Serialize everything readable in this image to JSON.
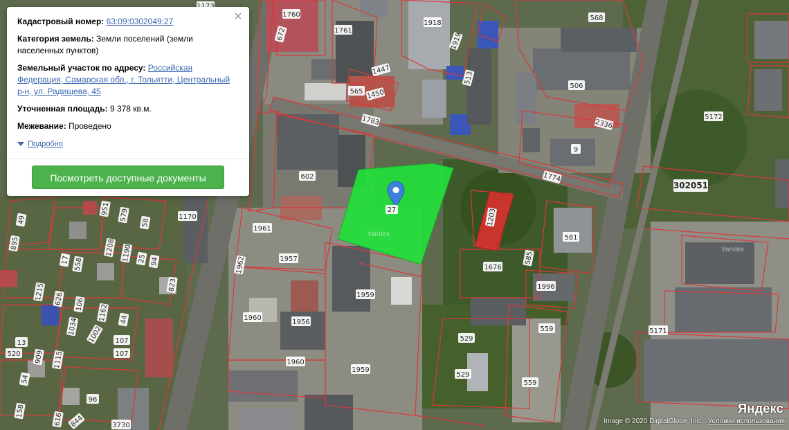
{
  "popup": {
    "cadastral_label": "Кадастровый номер:",
    "cadastral_value": "63:09:0302049:27",
    "category_label": "Категория земель:",
    "category_value": "Земли поселений (земли населенных пунктов)",
    "address_label": "Земельный участок по адресу:",
    "address_value": "Российская Федерация, Самарская обл., г. Тольятти, Центральный р-н, ул. Радищева, 45",
    "area_label": "Уточненная площадь:",
    "area_value": "9 378 кв.м.",
    "survey_label": "Межевание:",
    "survey_value": "Проведено",
    "more_label": "Подробно",
    "docs_button": "Посмотреть доступные документы",
    "close_symbol": "×"
  },
  "footer": {
    "copyright": "Image © 2020 DigitalGlobe, Inc.",
    "terms": "Условия использования",
    "logo": "Яндекс"
  },
  "watermarks": [
    "Yandex",
    "Yandex"
  ],
  "map_labels": {
    "l1760": "1760",
    "l1173": "1173",
    "l672": "672",
    "l1761": "1761",
    "l1918": "1918",
    "l1919": "1919",
    "l568": "568",
    "l1447": "1447",
    "l565": "565",
    "l1450": "1450",
    "l513": "513",
    "l506": "506",
    "l1783": "1783",
    "l2336": "2336",
    "l9": "9",
    "l5172": "5172",
    "l602": "602",
    "l1774": "1774",
    "l302051": "302051",
    "l1170": "1170",
    "l1203": "1203",
    "l1961": "1961",
    "l581": "581",
    "l1957": "1957",
    "l1962": "1962",
    "l1676": "1676",
    "l585": "585",
    "l1996": "1996",
    "l1959a": "1959",
    "l1960a": "1960",
    "l1956": "1956",
    "l5171": "5171",
    "l529a": "529",
    "l529b": "529",
    "l559a": "559",
    "l559b": "559",
    "l1960b": "1960",
    "l1959b": "1959",
    "l3730": "3730",
    "l951": "951",
    "l579": "579",
    "l58": "58",
    "l49": "49",
    "l1208": "1208",
    "l1190": "1190",
    "l25": "25",
    "l94": "94",
    "l558": "558",
    "l17": "17",
    "l895": "895",
    "l823": "823",
    "l626": "626",
    "l106": "106",
    "l1162": "1162",
    "l44": "44",
    "l1215": "1215",
    "l1034": "1034",
    "l1002": "1002",
    "l107a": "107",
    "l107b": "107",
    "l13": "13",
    "l520": "520",
    "l909": "909",
    "l1115": "1115",
    "l54": "54",
    "l96": "96",
    "l158": "158",
    "l616": "616",
    "l844": "844",
    "l27": "27"
  },
  "colors": {
    "selected_parcel": "#22e03a",
    "highlight_parcel": "#e03030",
    "boundary": "#d83a3a",
    "button": "#4cb34c",
    "link": "#3a67b0",
    "marker": "#3b82d8"
  }
}
